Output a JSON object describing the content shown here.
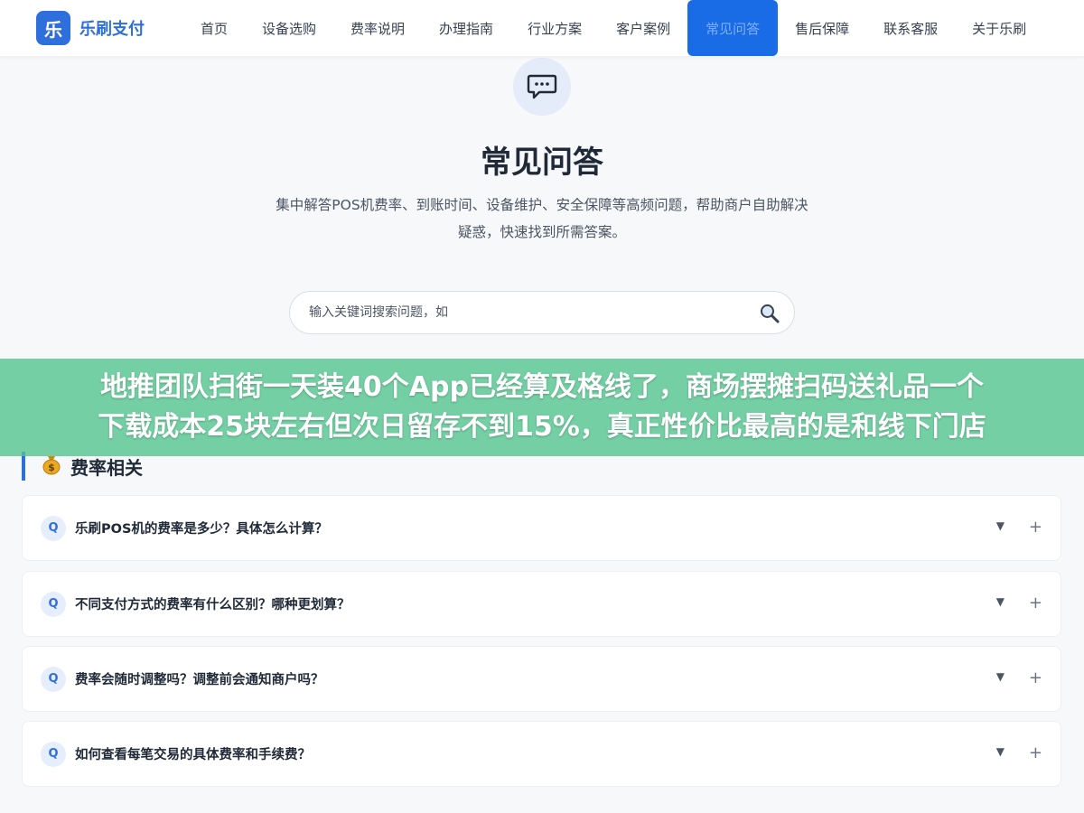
{
  "brand": {
    "logo_char": "乐",
    "name": "乐刷支付"
  },
  "nav": {
    "items": [
      {
        "label": "首页"
      },
      {
        "label": "设备选购"
      },
      {
        "label": "费率说明"
      },
      {
        "label": "办理指南"
      },
      {
        "label": "行业方案"
      },
      {
        "label": "客户案例"
      },
      {
        "label": "常见问答",
        "active": true
      },
      {
        "label": "售后保障"
      },
      {
        "label": "联系客服"
      },
      {
        "label": "关于乐刷"
      }
    ]
  },
  "hero": {
    "icon": "chat-bubble-icon",
    "title": "常见问答",
    "description": "集中解答POS机费率、到账时间、设备维护、安全保障等高频问题，帮助商户自助解决疑惑，快速找到所需答案。"
  },
  "search": {
    "placeholder": "输入关键词搜索问题，如",
    "icon": "search-icon"
  },
  "overlay": {
    "line1": "地推团队扫街一天装40个App已经算及格线了，商场摆摊扫码送礼品一个",
    "line2": "下载成本25块左右但次日留存不到15%，真正性价比最高的是和线下门店"
  },
  "section": {
    "icon": "money-bag-icon",
    "title": "费率相关",
    "items": [
      {
        "badge": "Q",
        "question": "乐刷POS机的费率是多少？具体怎么计算？"
      },
      {
        "badge": "Q",
        "question": "不同支付方式的费率有什么区别？哪种更划算？"
      },
      {
        "badge": "Q",
        "question": "费率会随时调整吗？调整前会通知商户吗？"
      },
      {
        "badge": "Q",
        "question": "如何查看每笔交易的具体费率和手续费？"
      }
    ]
  },
  "colors": {
    "brand": "#2f6fdb",
    "active_nav": "#1a6be6",
    "overlay": "#52c48e"
  }
}
